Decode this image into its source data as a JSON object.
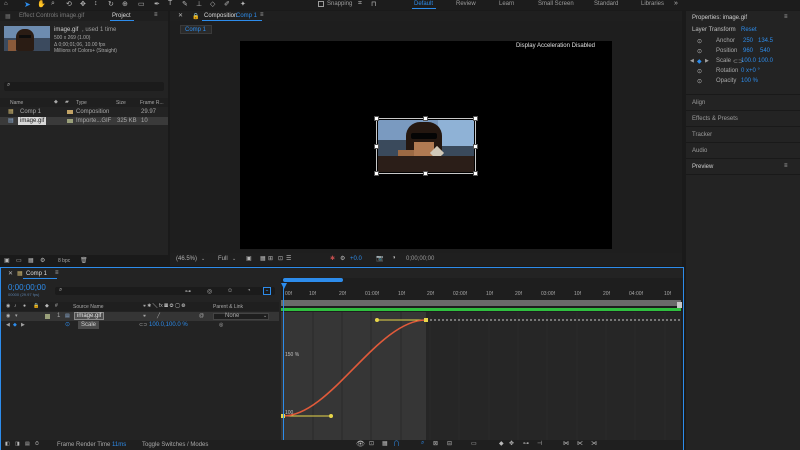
{
  "toolbar": {
    "snapping": "Snapping",
    "workspaces": [
      "Default",
      "Review",
      "Learn",
      "Small Screen",
      "Standard",
      "Libraries"
    ],
    "active_workspace": "Default"
  },
  "project_panel": {
    "tab_effect_controls": "Effect Controls image.gif",
    "tab_project": "Project",
    "file_name": "image.gif",
    "used": ", used 1 time",
    "dims": "500 x 269 (1.00)",
    "duration": "Δ 0;00;01;06, 10.00 fps",
    "colors": "Millions of Colors+ (Straight)",
    "search_placeholder": "",
    "columns": {
      "name": "Name",
      "type": "Type",
      "size": "Size",
      "frame_rate": "Frame R..."
    },
    "items": [
      {
        "name": "Comp 1",
        "type": "Composition",
        "size": "",
        "fps": "29.97"
      },
      {
        "name": "image.gif",
        "type": "Importe...GIF",
        "size": "325 KB",
        "fps": "10"
      }
    ],
    "bpc": "8 bpc"
  },
  "composition": {
    "tab": "Composition",
    "comp_name": "Comp 1",
    "breadcrumb": "Comp 1",
    "accel_notice": "Display Acceleration Disabled",
    "zoom": "(46.5%)",
    "resolution": "Full",
    "exposure": "+0.0",
    "timecode": "0;00;00;00"
  },
  "properties": {
    "title": "Properties: image.gif",
    "section": "Layer Transform",
    "reset": "Reset",
    "anchor_label": "Anchor",
    "anchor_values": [
      "250",
      "134.5"
    ],
    "position_label": "Position",
    "position_values": [
      "960",
      "540"
    ],
    "scale_label": "Scale",
    "scale_values": [
      "100.0",
      "100.0"
    ],
    "rotation_label": "Rotation",
    "rotation_value": "0 x+0 °",
    "opacity_label": "Opacity",
    "opacity_value": "100 %"
  },
  "side_panels": [
    "Align",
    "Effects & Presets",
    "Tracker",
    "Audio",
    "Preview"
  ],
  "timeline": {
    "tab": "Comp 1",
    "timecode": "0;00;00;00",
    "timecode_sub": "00000 (29.97 fps)",
    "col_source": "Source Name",
    "col_parent": "Parent & Link",
    "layer_index": "1",
    "layer_name": "image.gif",
    "parent_value": "None",
    "prop_name": "Scale",
    "prop_value": "100.0,100.0 %",
    "ruler": [
      "00f",
      "10f",
      "20f",
      "01:00f",
      "10f",
      "20f",
      "02:00f",
      "10f",
      "20f",
      "03:00f",
      "10f",
      "20f",
      "04:00f",
      "10f"
    ],
    "graph_label_top": "150 %",
    "graph_label_bottom": "100",
    "render_time_label": "Frame Render Time",
    "render_time_value": "11ms",
    "toggle_label": "Toggle Switches / Modes"
  }
}
